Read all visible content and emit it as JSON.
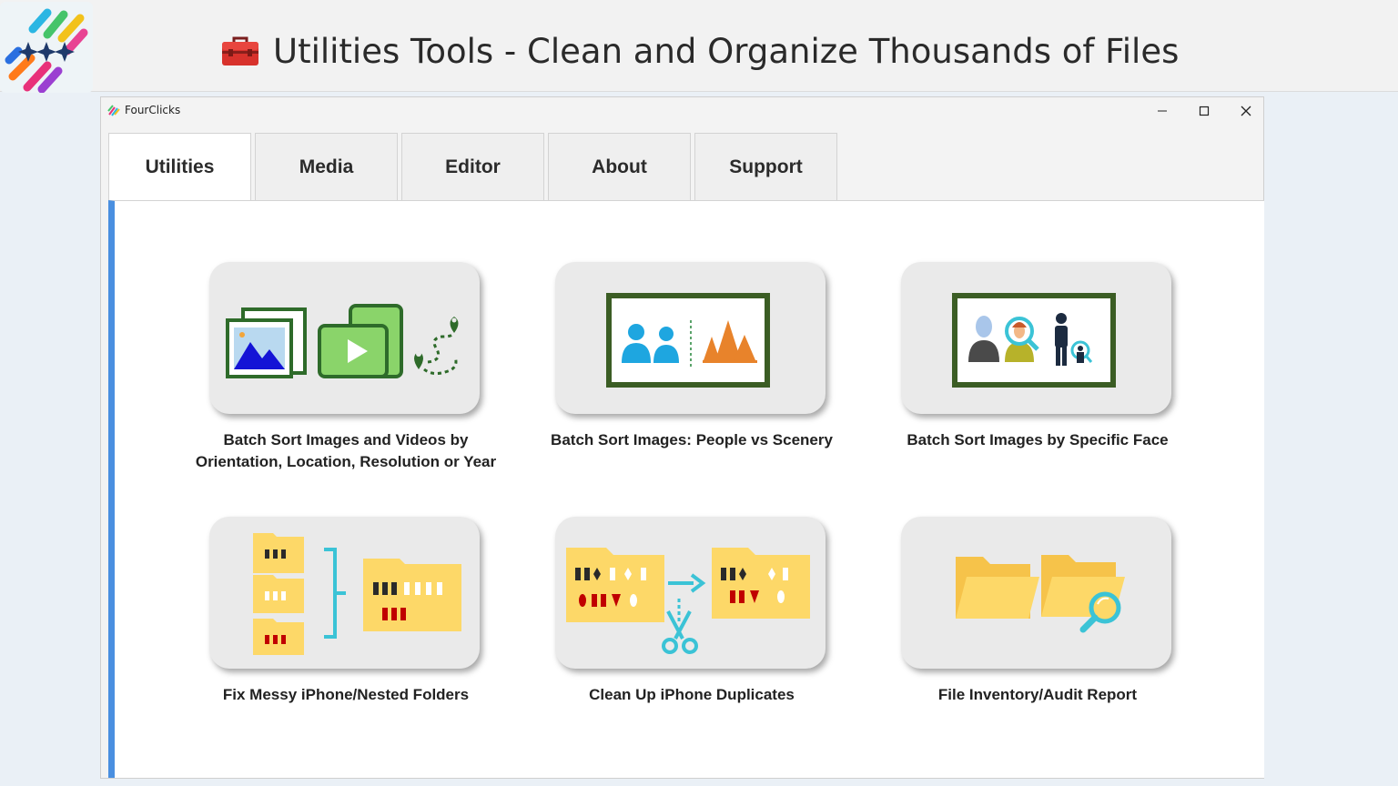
{
  "banner": {
    "title": "Utilities Tools - Clean and Organize Thousands of Files",
    "icon": "toolbox-icon"
  },
  "window": {
    "app_name": "FourClicks",
    "controls": [
      "minimize-icon",
      "maximize-icon",
      "close-icon"
    ]
  },
  "tabs": [
    {
      "label": "Utilities",
      "active": true
    },
    {
      "label": "Media",
      "active": false
    },
    {
      "label": "Editor",
      "active": false
    },
    {
      "label": "About",
      "active": false
    },
    {
      "label": "Support",
      "active": false
    }
  ],
  "cards": [
    {
      "label_line1": "Batch Sort Images and Videos by",
      "label_line2": "Orientation, Location, Resolution or Year",
      "icon": "images-videos-location-icon"
    },
    {
      "label_line1": "Batch Sort Images: People vs Scenery",
      "label_line2": "",
      "icon": "people-vs-scenery-icon"
    },
    {
      "label_line1": "Batch Sort Images by Specific Face",
      "label_line2": "",
      "icon": "face-search-icon"
    },
    {
      "label_line1": "Fix Messy iPhone/Nested Folders",
      "label_line2": "",
      "icon": "merge-folders-icon"
    },
    {
      "label_line1": "Clean Up iPhone Duplicates",
      "label_line2": "",
      "icon": "remove-duplicates-icon"
    },
    {
      "label_line1": "File Inventory/Audit Report",
      "label_line2": "",
      "icon": "folder-audit-icon"
    }
  ],
  "colors": {
    "accent": "#4a8fe0",
    "frame_green": "#375a1f",
    "folder_yellow": "#fdd868",
    "teal": "#3bc3d6"
  }
}
